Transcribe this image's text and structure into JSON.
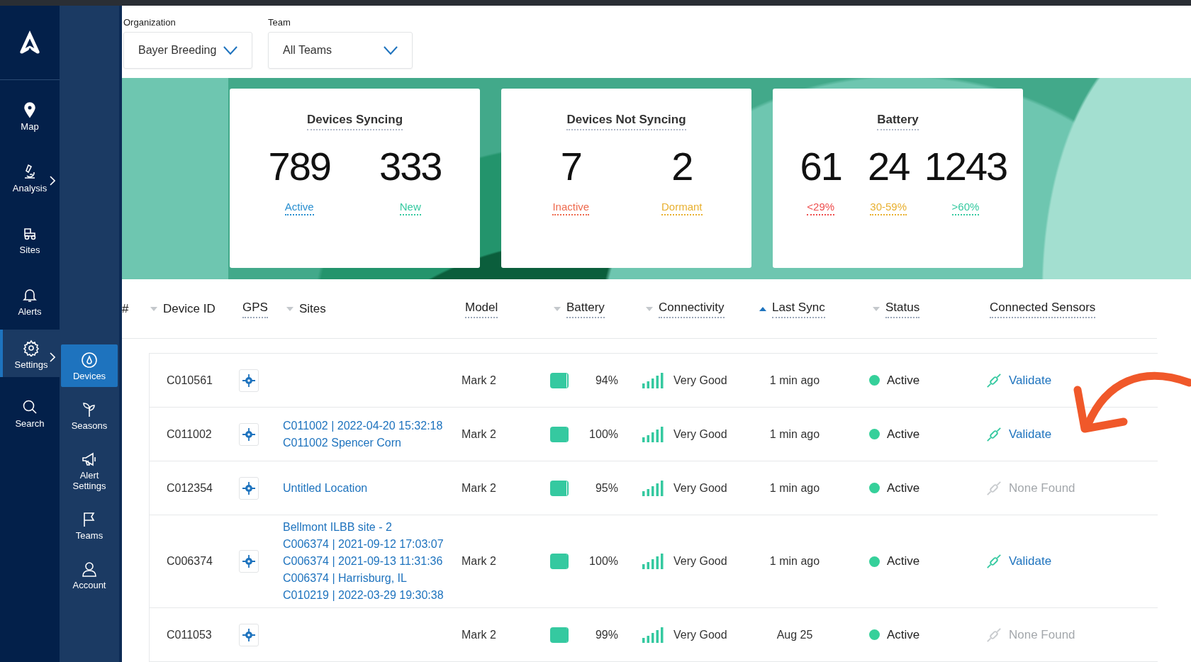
{
  "sidebar": {
    "items": [
      {
        "label": "Map",
        "kind": "pin",
        "selected": false,
        "has_submenu": false
      },
      {
        "label": "Analysis",
        "kind": "microscope",
        "selected": false,
        "has_submenu": true
      },
      {
        "label": "Sites",
        "kind": "tractor",
        "selected": false,
        "has_submenu": false
      },
      {
        "label": "Alerts",
        "kind": "bell",
        "selected": false,
        "has_submenu": false
      },
      {
        "label": "Settings",
        "kind": "gear",
        "selected": true,
        "has_submenu": true
      },
      {
        "label": "Search",
        "kind": "search",
        "selected": false,
        "has_submenu": false
      }
    ]
  },
  "submenu": {
    "items": [
      {
        "label": "Devices",
        "kind": "device",
        "selected": true
      },
      {
        "label": "Seasons",
        "kind": "sprout",
        "selected": false
      },
      {
        "label": "Alert Settings",
        "kind": "megaphone",
        "selected": false
      },
      {
        "label": "Teams",
        "kind": "flag",
        "selected": false
      },
      {
        "label": "Account",
        "kind": "person",
        "selected": false
      }
    ]
  },
  "filters": [
    {
      "label": "Organization",
      "value": "Bayer Breeding"
    },
    {
      "label": "Team",
      "value": "All Teams"
    }
  ],
  "summary_cards": [
    {
      "title": "Devices Syncing",
      "stats": [
        {
          "value": "789",
          "label": "Active",
          "color": "#2a8fd0"
        },
        {
          "value": "333",
          "label": "New",
          "color": "#35c9a0"
        }
      ]
    },
    {
      "title": "Devices Not Syncing",
      "stats": [
        {
          "value": "7",
          "label": "Inactive",
          "color": "#ee6a4e"
        },
        {
          "value": "2",
          "label": "Dormant",
          "color": "#e8b030"
        }
      ]
    },
    {
      "title": "Battery",
      "stats": [
        {
          "value": "61",
          "label": "<29%",
          "color": "#ee4e4e"
        },
        {
          "value": "24",
          "label": "30-59%",
          "color": "#e8b030"
        },
        {
          "value": "1243",
          "label": ">60%",
          "color": "#35c9a0"
        }
      ]
    }
  ],
  "table": {
    "columns": [
      {
        "label": "#",
        "sortable": false,
        "hint": false
      },
      {
        "label": "Device ID",
        "sortable": true,
        "sorted_ascending": false,
        "hint": false
      },
      {
        "label": "GPS",
        "sortable": false,
        "hint": true
      },
      {
        "label": "Sites",
        "sortable": true,
        "sorted_ascending": false,
        "hint": false
      },
      {
        "label": "Model",
        "sortable": false,
        "hint": true
      },
      {
        "label": "Battery",
        "sortable": true,
        "sorted_ascending": false,
        "hint": true
      },
      {
        "label": "Connectivity",
        "sortable": true,
        "sorted_ascending": false,
        "hint": true
      },
      {
        "label": "Last Sync",
        "sortable": true,
        "sorted_ascending": true,
        "hint": true
      },
      {
        "label": "Status",
        "sortable": true,
        "sorted_ascending": false,
        "hint": true
      },
      {
        "label": "Connected Sensors",
        "sortable": false,
        "hint": true
      }
    ],
    "rows": [
      {
        "device_id": "C010561",
        "sites": [],
        "model": "Mark 2",
        "battery": {
          "level": 0.94,
          "reading": "94%"
        },
        "connectivity": "Very Good",
        "last_sync": "1 min ago",
        "status": {
          "label": "Active",
          "color": "#35d09a"
        },
        "sensors": {
          "kind": "validate",
          "label": "Validate"
        }
      },
      {
        "device_id": "C011002",
        "sites": [
          "C011002 | 2022-04-20 15:32:18",
          "C011002 Spencer Corn"
        ],
        "model": "Mark 2",
        "battery": {
          "level": 1,
          "reading": "100%"
        },
        "connectivity": "Very Good",
        "last_sync": "1 min ago",
        "status": {
          "label": "Active",
          "color": "#35d09a"
        },
        "sensors": {
          "kind": "validate",
          "label": "Validate"
        }
      },
      {
        "device_id": "C012354",
        "sites": [
          "Untitled Location"
        ],
        "model": "Mark 2",
        "battery": {
          "level": 0.95,
          "reading": "95%"
        },
        "connectivity": "Very Good",
        "last_sync": "1 min ago",
        "status": {
          "label": "Active",
          "color": "#35d09a"
        },
        "sensors": {
          "kind": "none",
          "label": "None Found"
        }
      },
      {
        "device_id": "C006374",
        "sites": [
          "Bellmont ILBB site - 2",
          "C006374 | 2021-09-12 17:03:07",
          "C006374 | 2021-09-13 11:31:36",
          "C006374 | Harrisburg, IL",
          "C010219 | 2022-03-29 19:30:38"
        ],
        "model": "Mark 2",
        "battery": {
          "level": 1,
          "reading": "100%"
        },
        "connectivity": "Very Good",
        "last_sync": "1 min ago",
        "status": {
          "label": "Active",
          "color": "#35d09a"
        },
        "sensors": {
          "kind": "validate",
          "label": "Validate"
        }
      },
      {
        "device_id": "C011053",
        "sites": [],
        "model": "Mark 2",
        "battery": {
          "level": 0.99,
          "reading": "99%"
        },
        "connectivity": "Very Good",
        "last_sync": "Aug 25",
        "status": {
          "label": "Active",
          "color": "#35d09a"
        },
        "sensors": {
          "kind": "none",
          "label": "None Found"
        }
      }
    ]
  }
}
